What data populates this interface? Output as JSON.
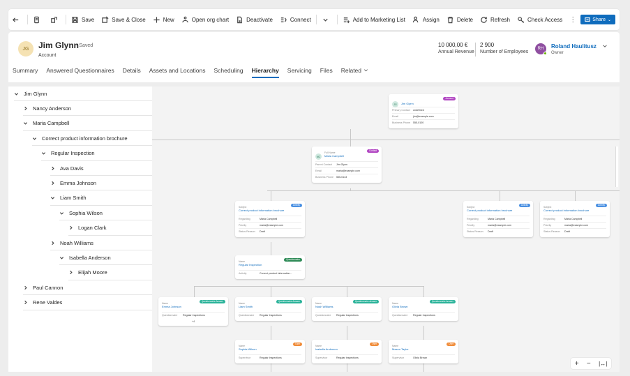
{
  "toolbar": {
    "save": "Save",
    "save_close": "Save & Close",
    "new": "New",
    "open_org_chart": "Open org chart",
    "deactivate": "Deactivate",
    "connect": "Connect",
    "add_marketing": "Add to Marketing List",
    "assign": "Assign",
    "delete": "Delete",
    "refresh": "Refresh",
    "check_access": "Check Access",
    "share": "Share"
  },
  "record": {
    "initials": "JG",
    "name": "Jim Glynn",
    "saved": "- Saved",
    "entity": "Account",
    "revenue_value": "10 000,00 €",
    "revenue_label": "Annual Revenue",
    "employees_value": "2 900",
    "employees_label": "Number of Employees",
    "owner_initials": "RH",
    "owner_name": "Roland Haulitusz",
    "owner_label": "Owner"
  },
  "tabs": [
    "Summary",
    "Answered Questionnaires",
    "Details",
    "Assets and Locations",
    "Scheduling",
    "Hierarchy",
    "Servicing",
    "Files",
    "Related"
  ],
  "tree": [
    {
      "label": "Jim Glynn",
      "state": "open"
    },
    {
      "label": "Nancy Anderson",
      "state": "closed"
    },
    {
      "label": "Maria Campbell",
      "state": "open"
    },
    {
      "label": "Correct product information brochure",
      "state": "open"
    },
    {
      "label": "Regular Inspection",
      "state": "open"
    },
    {
      "label": "Ava Davis",
      "state": "closed"
    },
    {
      "label": "Emma Johnson",
      "state": "closed"
    },
    {
      "label": "Liam Smith",
      "state": "open"
    },
    {
      "label": "Sophia Wilson",
      "state": "open"
    },
    {
      "label": "Logan Clark",
      "state": "closed"
    },
    {
      "label": "Noah Williams",
      "state": "closed"
    },
    {
      "label": "Isabella Anderson",
      "state": "open"
    },
    {
      "label": "Elijah Moore",
      "state": "closed"
    },
    {
      "label": "Paul Cannon",
      "state": "closed"
    },
    {
      "label": "Rene Valdes",
      "state": "closed"
    }
  ],
  "cards": {
    "account": {
      "initials": "JG",
      "name": "Jim Glynn",
      "badge": "Account",
      "rows": [
        [
          "Primary Contact",
          "undefined"
        ],
        [
          "Email",
          "jim@example.com"
        ],
        [
          "Business Phone",
          "555-0100"
        ]
      ]
    },
    "contact": {
      "initials": "MC",
      "kind": "Full Name",
      "name": "Maria Campbell",
      "badge": "Contact",
      "rows": [
        [
          "Parent Contact",
          "Jim Glynn"
        ],
        [
          "Email",
          "maria@example.com"
        ],
        [
          "Business Phone",
          "555-0143"
        ]
      ]
    },
    "act1": {
      "kind": "Subject",
      "name": "Correct product information brochure",
      "badge": "Activity",
      "rows": [
        [
          "Regarding",
          "Maria Campbell"
        ],
        [
          "Priority",
          "maria@example.com"
        ],
        [
          "Status Reason",
          "Draft"
        ]
      ]
    },
    "act2": {
      "kind": "Subject",
      "name": "Correct product information brochure",
      "badge": "Activity",
      "rows": [
        [
          "Regarding",
          "Maria Campbell"
        ],
        [
          "Priority",
          "maria@example.com"
        ],
        [
          "Status Reason",
          "Draft"
        ]
      ]
    },
    "act3": {
      "kind": "Subject",
      "name": "Correct product information brochure",
      "badge": "Activity",
      "rows": [
        [
          "Regarding",
          "Maria Campbell"
        ],
        [
          "Priority",
          "maria@example.com"
        ],
        [
          "Status Reason",
          "Draft"
        ]
      ]
    },
    "quest": {
      "kind": "Name",
      "name": "Regular Inspection",
      "badge": "Questionnaire",
      "rows": [
        [
          "Activity",
          "Correct product information..."
        ]
      ]
    },
    "q1": {
      "kind": "Name",
      "name": "Emma Johnson",
      "badge": "Questionnaire Answer",
      "rows": [
        [
          "Questionnaire",
          "Regular Inspections"
        ]
      ],
      "extra": "+4"
    },
    "q2": {
      "kind": "Name",
      "name": "Liam Smith",
      "badge": "Questionnaire Answer",
      "rows": [
        [
          "Questionnaire",
          "Regular Inspections"
        ]
      ]
    },
    "q3": {
      "kind": "Name",
      "name": "Noah Williams",
      "badge": "Questionnaire Answer",
      "rows": [
        [
          "Questionnaire",
          "Regular Inspections"
        ]
      ]
    },
    "q4": {
      "kind": "Name",
      "name": "Olivia Brown",
      "badge": "Questionnaire Answer",
      "rows": [
        [
          "Questionnaire",
          "Regular Inspections"
        ]
      ]
    },
    "u1": {
      "kind": "Name",
      "name": "Sophia Wilson",
      "badge": "User",
      "rows": [
        [
          "Supervisor",
          "Regular Inspections"
        ]
      ]
    },
    "u2": {
      "kind": "Name",
      "name": "Isabella Anderson",
      "badge": "User",
      "rows": [
        [
          "Supervisor",
          "Regular Inspections"
        ]
      ]
    },
    "u3": {
      "kind": "Name",
      "name": "Mason Taylor",
      "badge": "User",
      "rows": [
        [
          "Supervisor",
          "Olivia Brown"
        ]
      ]
    }
  },
  "colors": {
    "accent": "#0f6cbd",
    "account_badge": "#b146c2",
    "activity_badge": "#4a90e2",
    "questionnaire_badge": "#2e8b57",
    "answer_badge": "#2bb39a",
    "user_badge": "#f08c3a"
  }
}
